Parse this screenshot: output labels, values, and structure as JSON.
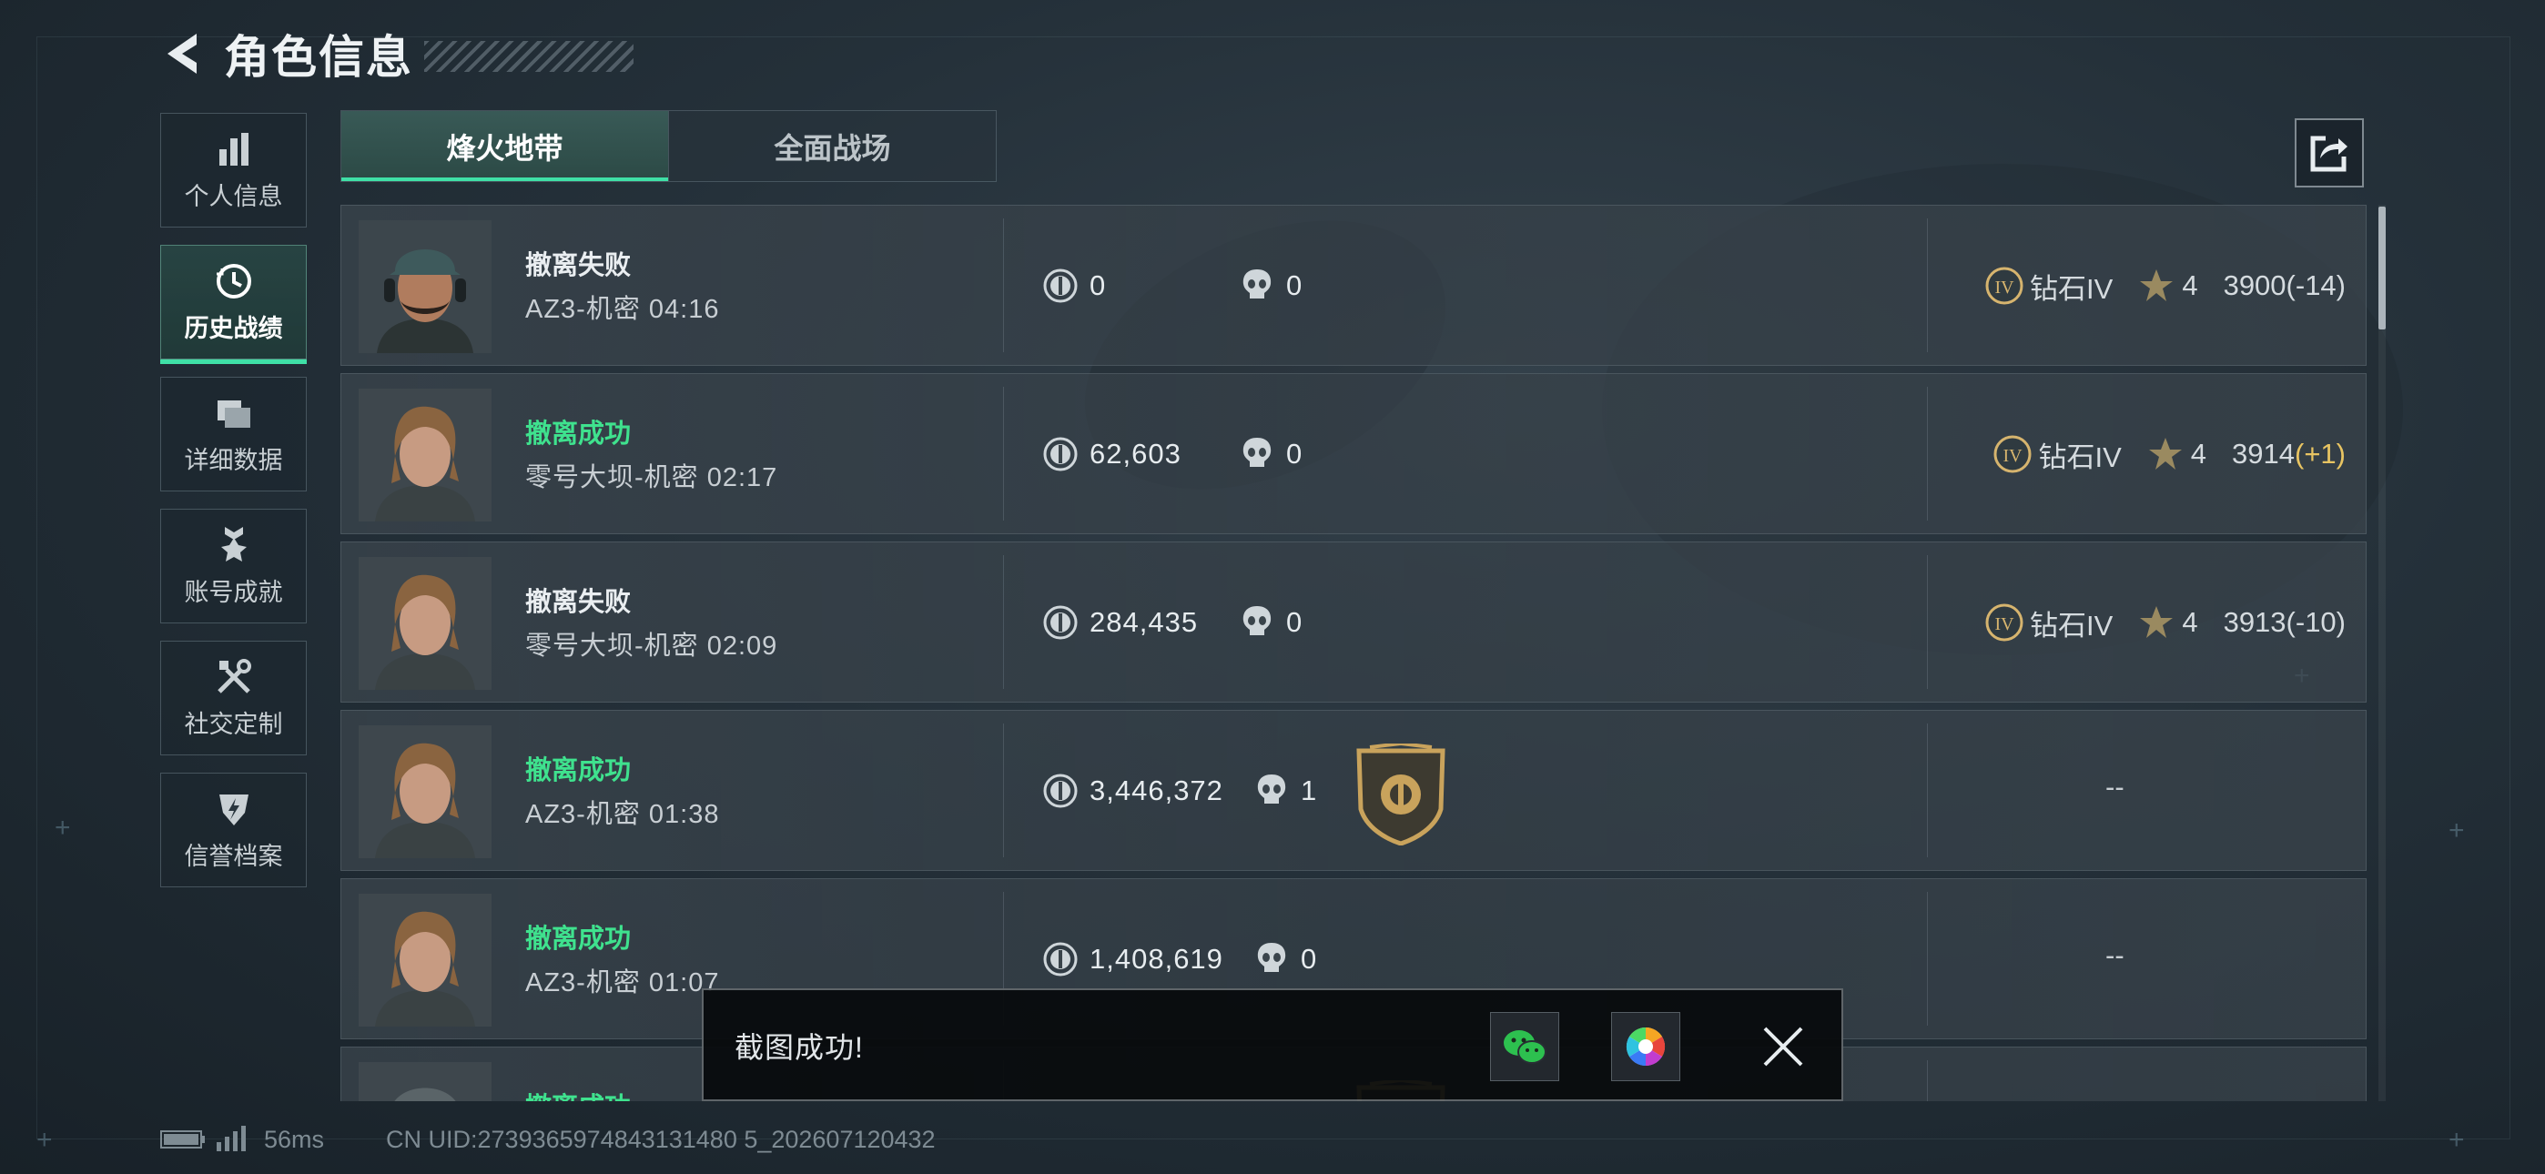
{
  "header": {
    "title": "角色信息"
  },
  "sidebar": {
    "items": [
      {
        "label": "个人信息",
        "icon": "bar-chart-icon",
        "active": false
      },
      {
        "label": "历史战绩",
        "icon": "history-clock-icon",
        "active": true
      },
      {
        "label": "详细数据",
        "icon": "folders-icon",
        "active": false
      },
      {
        "label": "账号成就",
        "icon": "medal-icon",
        "active": false
      },
      {
        "label": "社交定制",
        "icon": "tools-icon",
        "active": false
      },
      {
        "label": "信誉档案",
        "icon": "credit-shield-icon",
        "active": false
      }
    ]
  },
  "tabs": [
    {
      "label": "烽火地带",
      "active": true
    },
    {
      "label": "全面战场",
      "active": false
    }
  ],
  "records": [
    {
      "status": "撤离失败",
      "success": false,
      "map": "AZ3-机密 04:16",
      "coins": "0",
      "kills": "0",
      "rank_tier": "钻石IV",
      "stars": "4",
      "score": "3900",
      "delta": "(-14)",
      "avatar": "soldier-cap-headset"
    },
    {
      "status": "撤离成功",
      "success": true,
      "map": "零号大坝-机密 02:17",
      "coins": "62,603",
      "kills": "0",
      "rank_tier": "钻石IV",
      "stars": "4",
      "score": "3914",
      "delta": "(+1)",
      "avatar": "soldier-long-hair"
    },
    {
      "status": "撤离失败",
      "success": false,
      "map": "零号大坝-机密 02:09",
      "coins": "284,435",
      "kills": "0",
      "rank_tier": "钻石IV",
      "stars": "4",
      "score": "3913",
      "delta": "(-10)",
      "avatar": "soldier-long-hair"
    },
    {
      "status": "撤离成功",
      "success": true,
      "map": "AZ3-机密 01:38",
      "coins": "3,446,372",
      "kills": "1",
      "badge": "gold-shield-badge",
      "no_rank": "--",
      "avatar": "soldier-long-hair"
    },
    {
      "status": "撤离成功",
      "success": true,
      "map": "AZ3-机密 01:07",
      "coins": "1,408,619",
      "kills": "0",
      "no_rank": "--",
      "avatar": "soldier-long-hair"
    },
    {
      "status": "撤离成功",
      "success": true,
      "map": "",
      "coins": "",
      "kills": "",
      "badge": "gold-shield-badge",
      "avatar": "soldier-helmet"
    }
  ],
  "toast": {
    "message": "截图成功!",
    "wechat_icon": "wechat-icon",
    "gallery_icon": "gallery-icon",
    "close_icon": "close-icon"
  },
  "footer": {
    "ping": "56ms",
    "uid": "CN UID:2739365974843131480 5_202607120432"
  },
  "colors": {
    "accent": "#3fe0a6",
    "success": "#3fe28e",
    "positive_delta": "#e8c462"
  }
}
